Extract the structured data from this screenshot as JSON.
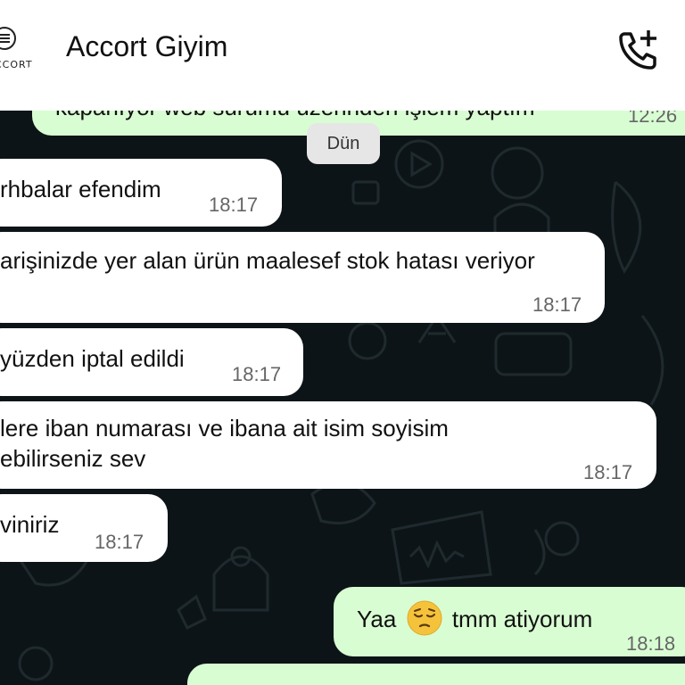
{
  "header": {
    "title": "Accort Giyim",
    "avatar_text": "CCORT"
  },
  "date_chip": "Dün",
  "messages": [
    {
      "direction": "out",
      "text": "kapanıyor web sürümü üzerinden işlem yaptım",
      "time": "12:26"
    },
    {
      "direction": "in",
      "lines": [
        "rhbalar efendim"
      ],
      "time": "18:17"
    },
    {
      "direction": "in",
      "lines": [
        "arişinizde yer alan ürün maalesef stok hatası veriyor"
      ],
      "time": "18:17"
    },
    {
      "direction": "in",
      "lines": [
        "yüzden iptal edildi"
      ],
      "time": "18:17"
    },
    {
      "direction": "in",
      "lines": [
        "lere iban numarası ve ibana ait isim soyisim",
        "ebilirseniz sev"
      ],
      "time": "18:17"
    },
    {
      "direction": "in",
      "lines": [
        "viniriz"
      ],
      "time": "18:17"
    },
    {
      "direction": "out",
      "before_emoji": "Yaa",
      "emoji": "pensive-face",
      "after_emoji": "tmm atiyorum",
      "time": "18:18"
    }
  ]
}
